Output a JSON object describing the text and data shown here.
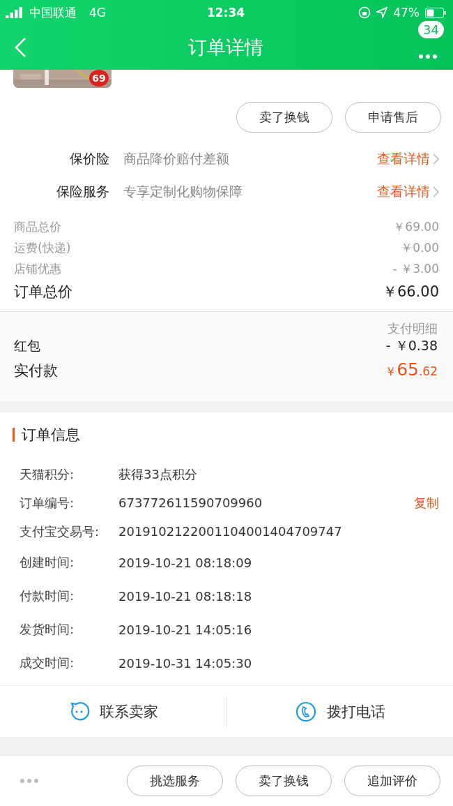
{
  "status_bar": {
    "carrier": "中国联通",
    "network": "4G",
    "time": "12:34",
    "battery": "47%"
  },
  "nav": {
    "title": "订单详情",
    "badge": "34"
  },
  "product": {
    "price_badge": "69"
  },
  "actions": [
    "卖了换钱",
    "申请售后"
  ],
  "services": [
    {
      "label": "保价险",
      "desc": "商品降价赔付差额",
      "link": "查看详情"
    },
    {
      "label": "保险服务",
      "desc": "专享定制化购物保障",
      "link": "查看详情"
    }
  ],
  "price_rows": [
    {
      "label": "商品总价",
      "value": "￥69.00",
      "kind": "normal"
    },
    {
      "label": "运费(快递)",
      "value": "￥0.00",
      "kind": "normal"
    },
    {
      "label": "店铺优惠",
      "value": "- ￥3.00",
      "kind": "normal"
    },
    {
      "label": "订单总价",
      "value": "￥66.00",
      "kind": "total"
    }
  ],
  "payment": {
    "title": "支付明细",
    "rows": [
      {
        "label": "红包",
        "value": "- ￥0.38"
      }
    ],
    "paid": {
      "label": "实付款",
      "currency": "￥",
      "integer": "65",
      "decimal": ".62"
    }
  },
  "order_info": {
    "title": "订单信息",
    "rows": [
      {
        "label": "天猫积分:",
        "value": "获得33点积分"
      },
      {
        "label": "订单编号:",
        "value": "673772611590709960",
        "action": "复制"
      },
      {
        "label": "支付宝交易号:",
        "value": "2019102122001104001404709747"
      },
      {
        "label": "创建时间:",
        "value": "2019-10-21 08:18:09"
      },
      {
        "label": "付款时间:",
        "value": "2019-10-21 08:18:18"
      },
      {
        "label": "发货时间:",
        "value": "2019-10-21 14:05:16"
      },
      {
        "label": "成交时间:",
        "value": "2019-10-31 14:05:30"
      }
    ]
  },
  "contact": [
    {
      "kind": "chat",
      "label": "联系卖家"
    },
    {
      "kind": "phone",
      "label": "拨打电话"
    }
  ],
  "bottom_buttons": [
    "挑选服务",
    "卖了换钱",
    "追加评价"
  ]
}
